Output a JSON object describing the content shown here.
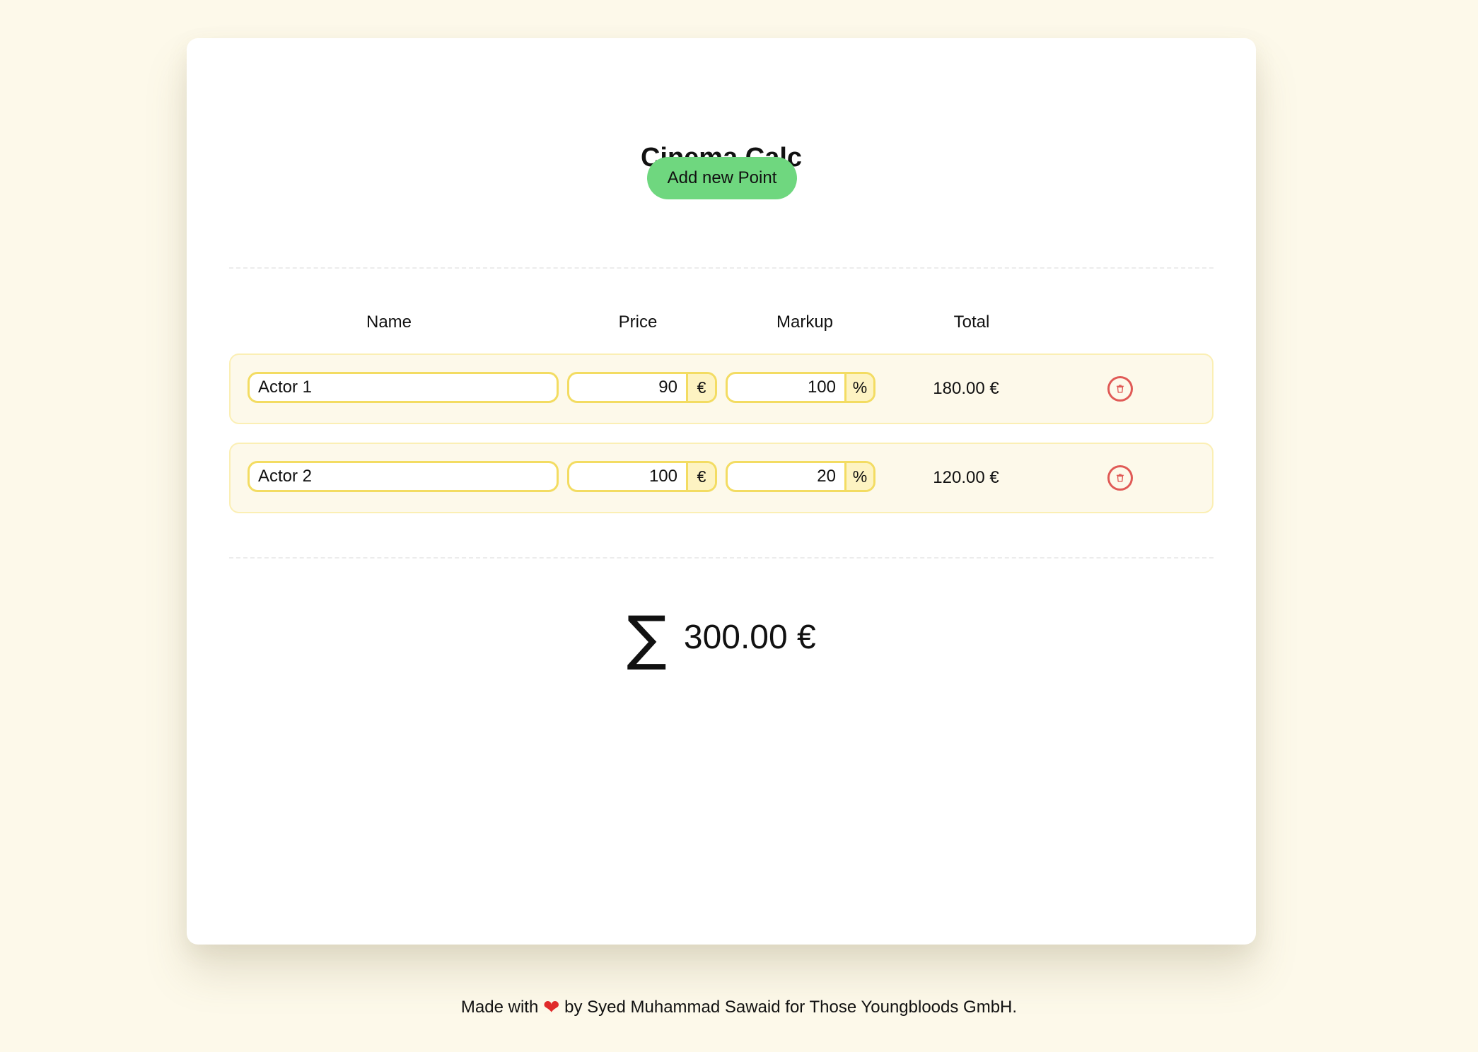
{
  "app": {
    "title": "Cinema Calc",
    "add_button_label": "Add new Point"
  },
  "table": {
    "headers": {
      "name": "Name",
      "price": "Price",
      "markup": "Markup",
      "total": "Total"
    },
    "rows": [
      {
        "name": "Actor 1",
        "price": "90",
        "price_unit": "€",
        "markup": "100",
        "markup_unit": "%",
        "total": "180.00 €"
      },
      {
        "name": "Actor 2",
        "price": "100",
        "price_unit": "€",
        "markup": "20",
        "markup_unit": "%",
        "total": "120.00 €"
      }
    ]
  },
  "summary": {
    "symbol": "∑",
    "total": "300.00 €"
  },
  "footer": {
    "prefix": "Made with",
    "heart": "❤",
    "suffix": "by Syed Muhammad Sawaid for Those Youngbloods GmbH."
  },
  "colors": {
    "background": "#fdf9ea",
    "add_button": "#6fd77f",
    "field_border": "#f3dc62",
    "delete_icon": "#e05a56",
    "heart": "#e02b2b"
  },
  "icons": {
    "delete": "trash-icon",
    "footer": "heart-icon"
  }
}
